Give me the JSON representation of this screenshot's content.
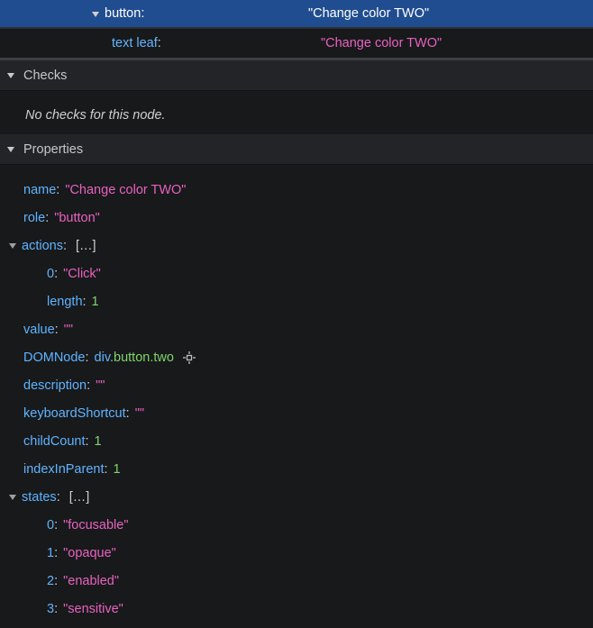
{
  "tree": {
    "node": {
      "role": "button",
      "value": "\"Change color TWO\""
    },
    "child": {
      "role": "text leaf",
      "value": "\"Change color TWO\""
    }
  },
  "checks": {
    "title": "Checks",
    "empty": "No checks for this node."
  },
  "properties": {
    "title": "Properties",
    "name": {
      "key": "name",
      "value": "\"Change color TWO\""
    },
    "role": {
      "key": "role",
      "value": "\"button\""
    },
    "actions": {
      "key": "actions",
      "brackets": "[…]",
      "items": [
        {
          "key": "0",
          "value": "\"Click\""
        }
      ],
      "length": {
        "key": "length",
        "value": "1"
      }
    },
    "value": {
      "key": "value",
      "value": "\"\""
    },
    "DOMNode": {
      "key": "DOMNode",
      "tag": "div",
      "cls": ".button.two"
    },
    "description": {
      "key": "description",
      "value": "\"\""
    },
    "keyboardShortcut": {
      "key": "keyboardShortcut",
      "value": "\"\""
    },
    "childCount": {
      "key": "childCount",
      "value": "1"
    },
    "indexInParent": {
      "key": "indexInParent",
      "value": "1"
    },
    "states": {
      "key": "states",
      "brackets": "[…]",
      "items": [
        {
          "key": "0",
          "value": "\"focusable\""
        },
        {
          "key": "1",
          "value": "\"opaque\""
        },
        {
          "key": "2",
          "value": "\"enabled\""
        },
        {
          "key": "3",
          "value": "\"sensitive\""
        }
      ]
    }
  }
}
